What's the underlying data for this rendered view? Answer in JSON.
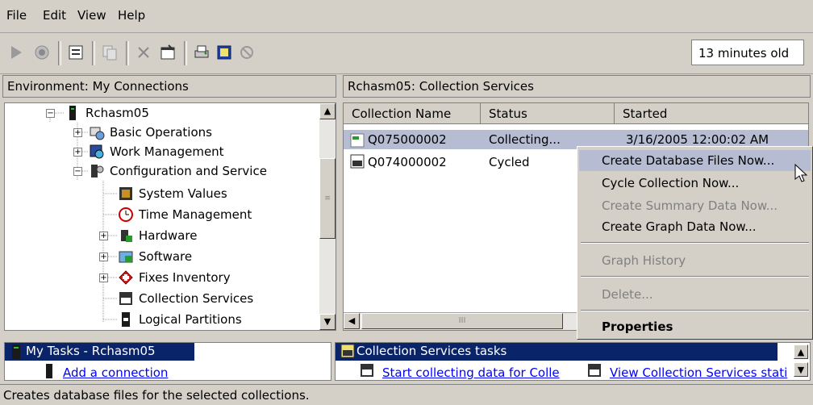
{
  "menu": {
    "file": "File",
    "edit": "Edit",
    "view": "View",
    "help": "Help"
  },
  "toolbar": {
    "age": "13 minutes old"
  },
  "left_panel": {
    "title": "Environment: My Connections"
  },
  "right_panel": {
    "title": "Rchasm05:  Collection Services"
  },
  "tree": {
    "items": [
      {
        "label": "Rchasm05"
      },
      {
        "label": "Basic Operations"
      },
      {
        "label": "Work Management"
      },
      {
        "label": "Configuration and Service"
      },
      {
        "label": "System Values"
      },
      {
        "label": "Time Management"
      },
      {
        "label": "Hardware"
      },
      {
        "label": "Software"
      },
      {
        "label": "Fixes Inventory"
      },
      {
        "label": "Collection Services"
      },
      {
        "label": "Logical Partitions"
      }
    ]
  },
  "list": {
    "columns": {
      "name": "Collection Name",
      "status": "Status",
      "started": "Started"
    },
    "rows": [
      {
        "name": "Q075000002",
        "status": "Collecting...",
        "started": "3/16/2005 12:00:02 AM"
      },
      {
        "name": "Q074000002",
        "status": "Cycled",
        "started": ""
      }
    ],
    "hscroll_glyph": "III"
  },
  "context_menu": {
    "create_db": "Create Database Files Now...",
    "cycle": "Cycle Collection Now...",
    "summary": "Create Summary Data Now...",
    "graph_data": "Create Graph Data Now...",
    "graph_history": "Graph History",
    "delete": "Delete...",
    "properties": "Properties"
  },
  "tasks": {
    "left_title": "My Tasks - Rchasm05",
    "left_link": "Add a connection",
    "right_title": "Collection Services tasks",
    "right_link1": "Start collecting data for Colle",
    "right_link2": "View Collection Services stati"
  },
  "status_bar": {
    "text": "Creates database files for the selected collections."
  },
  "colors": {
    "selection": "#0a246a",
    "highlight": "#b6bdd2",
    "link": "#0000ff",
    "face": "#d4d0c8"
  }
}
